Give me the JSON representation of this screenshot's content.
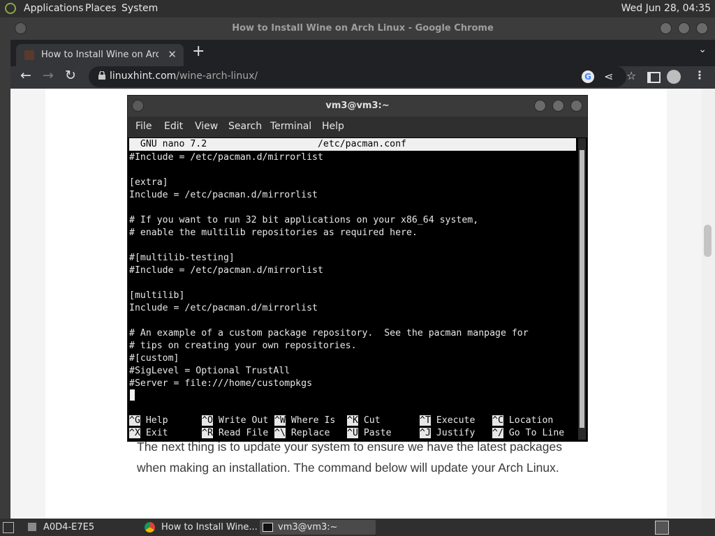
{
  "panel": {
    "menus": [
      "Applications",
      "Places",
      "System"
    ],
    "clock": "Wed Jun 28, 04:35"
  },
  "chrome": {
    "window_title": "How to Install Wine on Arch Linux - Google Chrome",
    "tab_title": "How to Install Wine on Arch Li",
    "url_domain": "linuxhint.com",
    "url_path": "/wine-arch-linux/"
  },
  "page": {
    "paragraph": "The next thing is to update your system to ensure we have the latest packages when making an installation. The command below will update your Arch Linux."
  },
  "terminal": {
    "title": "vm3@vm3:~",
    "menus": [
      "File",
      "Edit",
      "View",
      "Search",
      "Terminal",
      "Help"
    ],
    "nano_header": "  GNU nano 7.2                    /etc/pacman.conf",
    "lines": [
      "#Include = /etc/pacman.d/mirrorlist",
      "",
      "[extra]",
      "Include = /etc/pacman.d/mirrorlist",
      "",
      "# If you want to run 32 bit applications on your x86_64 system,",
      "# enable the multilib repositories as required here.",
      "",
      "#[multilib-testing]",
      "#Include = /etc/pacman.d/mirrorlist",
      "",
      "[multilib]",
      "Include = /etc/pacman.d/mirrorlist",
      "",
      "# An example of a custom package repository.  See the pacman manpage for",
      "# tips on creating your own repositories.",
      "#[custom]",
      "#SigLevel = Optional TrustAll",
      "#Server = file:///home/custompkgs"
    ],
    "shortcuts_row1": [
      {
        "key": "^G",
        "label": "Help"
      },
      {
        "key": "^O",
        "label": "Write Out"
      },
      {
        "key": "^W",
        "label": "Where Is"
      },
      {
        "key": "^K",
        "label": "Cut"
      },
      {
        "key": "^T",
        "label": "Execute"
      },
      {
        "key": "^C",
        "label": "Location"
      }
    ],
    "shortcuts_row2": [
      {
        "key": "^X",
        "label": "Exit"
      },
      {
        "key": "^R",
        "label": "Read File"
      },
      {
        "key": "^\\",
        "label": "Replace"
      },
      {
        "key": "^U",
        "label": "Paste"
      },
      {
        "key": "^J",
        "label": "Justify"
      },
      {
        "key": "^/",
        "label": "Go To Line"
      }
    ]
  },
  "taskbar": {
    "items": [
      "A0D4-E7E5",
      "How to Install Wine...",
      "vm3@vm3:~"
    ]
  }
}
